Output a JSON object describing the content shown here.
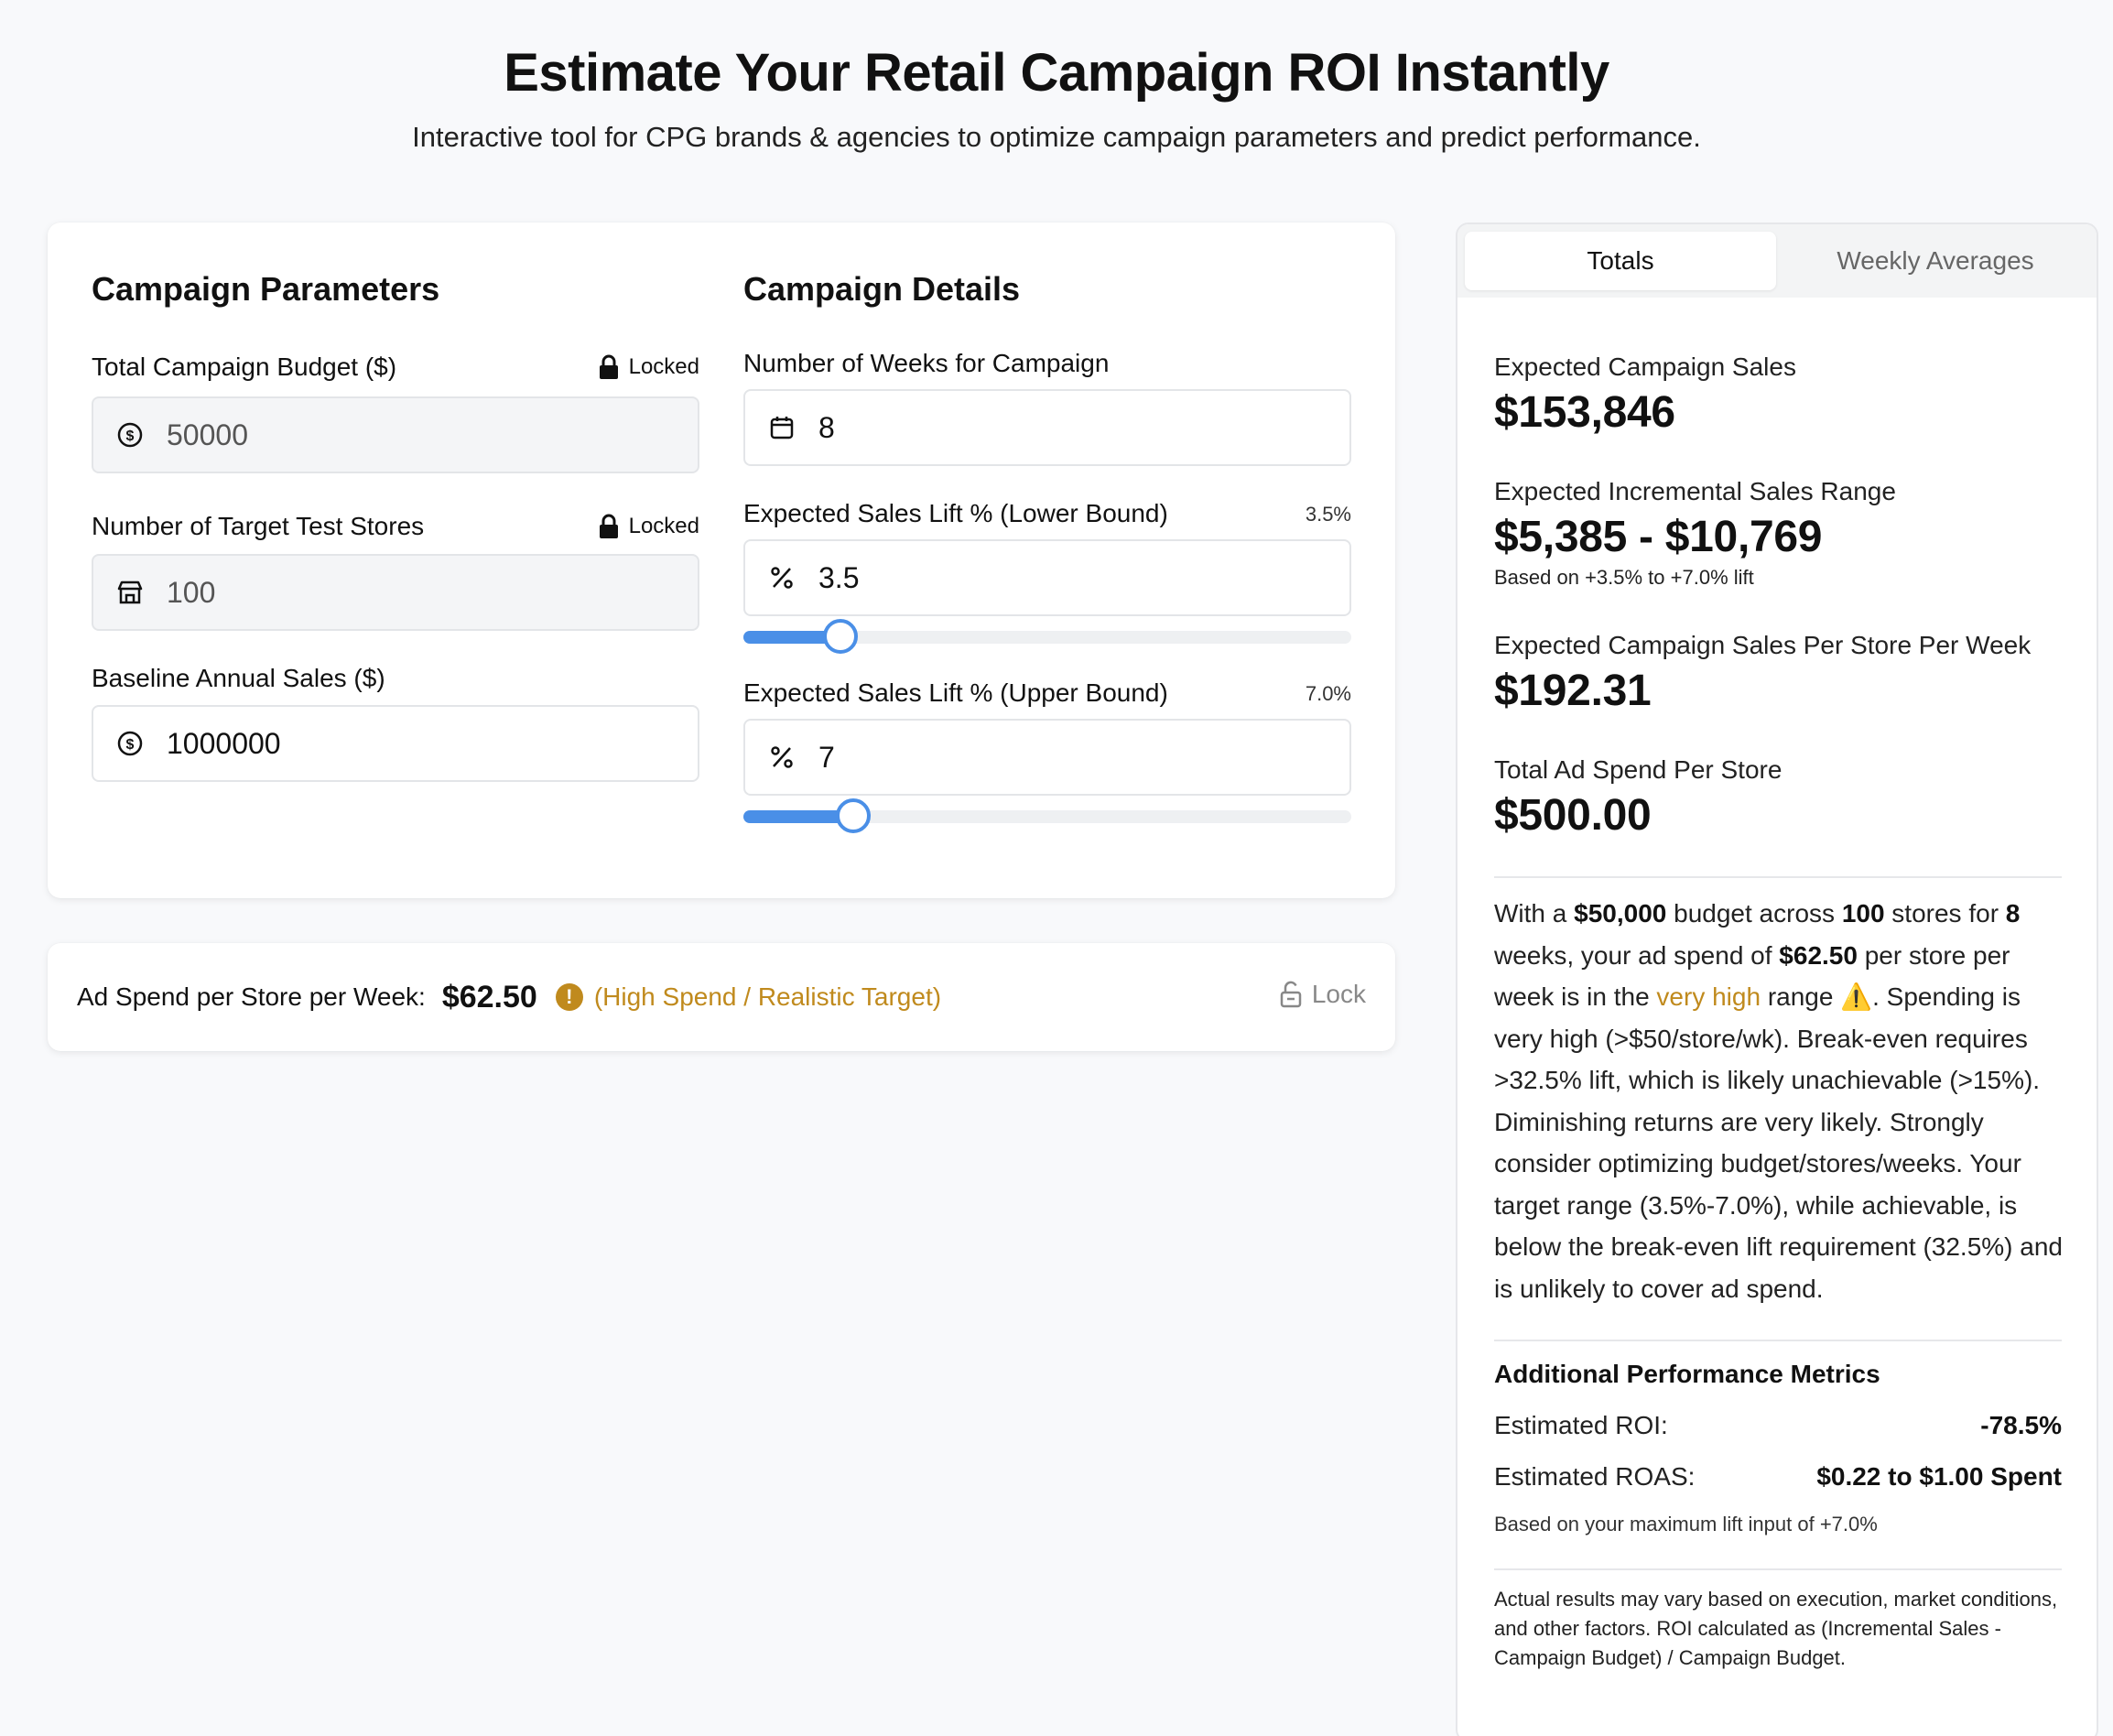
{
  "header": {
    "title": "Estimate Your Retail Campaign ROI Instantly",
    "subtitle": "Interactive tool for CPG brands & agencies to optimize campaign parameters and predict performance."
  },
  "parameters": {
    "title": "Campaign Parameters",
    "budget": {
      "label": "Total Campaign Budget ($)",
      "lock_text": "Locked",
      "value": "50000",
      "icon": "dollar-circle-icon"
    },
    "stores": {
      "label": "Number of Target Test Stores",
      "lock_text": "Locked",
      "value": "100",
      "icon": "store-icon"
    },
    "baseline": {
      "label": "Baseline Annual Sales ($)",
      "value": "1000000",
      "icon": "dollar-circle-icon"
    }
  },
  "details": {
    "title": "Campaign Details",
    "weeks": {
      "label": "Number of Weeks for Campaign",
      "value": "8",
      "icon": "calendar-icon"
    },
    "lift_lower": {
      "label": "Expected Sales Lift % (Lower Bound)",
      "display": "3.5%",
      "value": "3.5",
      "slider_fraction": 0.16,
      "icon": "percent-icon"
    },
    "lift_upper": {
      "label": "Expected Sales Lift % (Upper Bound)",
      "display": "7.0%",
      "value": "7",
      "slider_fraction": 0.18,
      "icon": "percent-icon"
    }
  },
  "spend": {
    "label": "Ad Spend per Store per Week:",
    "value": "$62.50",
    "status": "(High Spend / Realistic Target)",
    "lock_label": "Lock",
    "status_color": "#c08a1d"
  },
  "tabs": {
    "totals": "Totals",
    "weekly": "Weekly Averages"
  },
  "results": {
    "sales_label": "Expected Campaign Sales",
    "sales_value": "$153,846",
    "incremental_label": "Expected Incremental Sales Range",
    "incremental_value": "$5,385 - $10,769",
    "incremental_note": "Based on +3.5% to +7.0% lift",
    "per_store_week_label": "Expected Campaign Sales Per Store Per Week",
    "per_store_week_value": "$192.31",
    "ad_spend_store_label": "Total Ad Spend Per Store",
    "ad_spend_store_value": "$500.00"
  },
  "summary": {
    "p1": "With a ",
    "budget": "$50,000",
    "p2": " budget across ",
    "stores": "100",
    "p3": " stores for ",
    "weeks": "8",
    "p4": " weeks, your ad spend of ",
    "spend": "$62.50",
    "p5": " per store per week is in the ",
    "range_word": "very high",
    "p6": " range ⚠️. Spending is very high (>$50/store/wk). Break-even requires >32.5% lift, which is likely unachievable (>15%). Diminishing returns are very likely. Strongly consider optimizing budget/stores/weeks. Your target range (3.5%-7.0%), while achievable, is below the break-even lift requirement (32.5%) and is unlikely to cover ad spend."
  },
  "additional": {
    "title": "Additional Performance Metrics",
    "roi_label": "Estimated ROI:",
    "roi_value": "-78.5%",
    "roas_label": "Estimated ROAS:",
    "roas_value": "$0.22 to $1.00 Spent",
    "note": "Based on your maximum lift input of +7.0%",
    "disclaimer": "Actual results may vary based on execution, market conditions, and other factors. ROI calculated as (Incremental Sales - Campaign Budget) / Campaign Budget."
  }
}
